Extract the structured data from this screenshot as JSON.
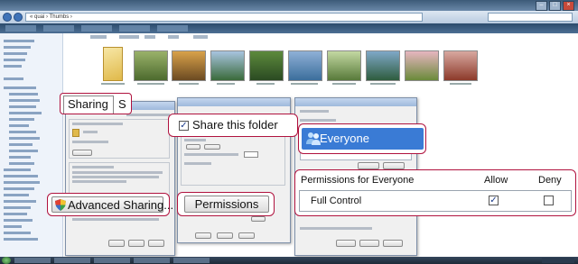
{
  "explorer": {
    "address_path": "« quai › Thumbs ›"
  },
  "sharing_tab": {
    "tab_label": "Sharing",
    "next_tab_label": "S"
  },
  "share_folder": {
    "label": "Share this folder",
    "checked": true,
    "check_glyph": "✓"
  },
  "advanced_sharing": {
    "label": "Advanced Sharing..."
  },
  "permissions_button": {
    "label": "Permissions"
  },
  "user_selection": {
    "label": "Everyone"
  },
  "permissions_table": {
    "header_label": "Permissions for Everyone",
    "allow_label": "Allow",
    "deny_label": "Deny",
    "rows": [
      {
        "label": "Full Control",
        "allow": true,
        "deny": false,
        "allow_glyph": "✓",
        "deny_glyph": ""
      }
    ]
  },
  "icons": {
    "shield": "uac-shield-icon",
    "users": "users-icon",
    "checkbox": "checkbox-icon",
    "folder": "folder-icon"
  },
  "colors": {
    "callout_border": "#b0123e",
    "selection_blue": "#3a7bd5",
    "title_bar": "#3c5a78"
  }
}
